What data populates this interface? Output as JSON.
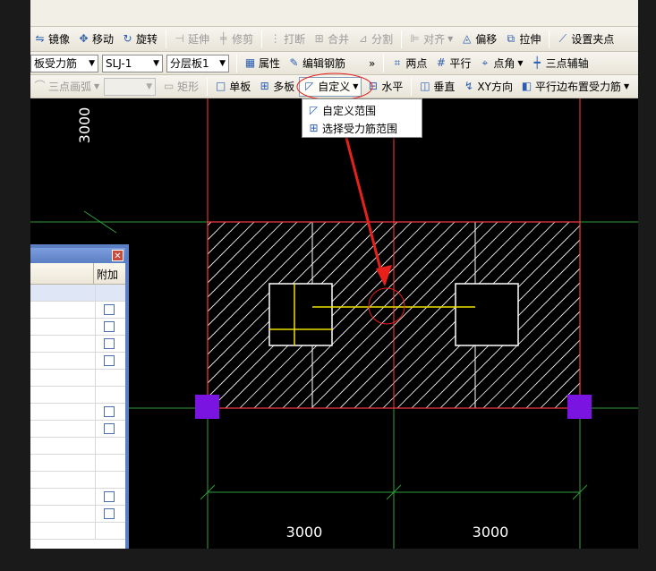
{
  "toolbar_top": {
    "partial_left": "",
    "partial_right": ""
  },
  "toolbar_edit": {
    "mirror": "镜像",
    "move": "移动",
    "rotate": "旋转",
    "extend": "延伸",
    "trim": "修剪",
    "break": "打断",
    "merge": "合并",
    "split": "分割",
    "align": "对齐",
    "offset": "偏移",
    "stretch": "拉伸",
    "set_grip": "设置夹点"
  },
  "toolbar_props": {
    "type_select": "板受力筋",
    "name_select": "SLJ-1",
    "layer_select": "分层板1",
    "properties": "属性",
    "edit_rebar": "编辑钢筋",
    "two_points": "两点",
    "parallel": "平行",
    "point_angle": "点角",
    "three_point_aux": "三点辅轴"
  },
  "toolbar_draw": {
    "three_point_arc": "三点画弧",
    "rectangle": "矩形",
    "single_board": "单板",
    "multi_board": "多板",
    "custom": "自定义",
    "horizontal": "水平",
    "vertical": "垂直",
    "xy_direction": "XY方向",
    "parallel_edge": "平行边布置受力筋"
  },
  "custom_menu": {
    "items": [
      "自定义范围",
      "选择受力筋范围"
    ]
  },
  "panel": {
    "column_header": "附加",
    "rows": [
      {
        "checkbox": false,
        "highlight": true
      },
      {
        "checkbox": true
      },
      {
        "checkbox": true
      },
      {
        "checkbox": true
      },
      {
        "checkbox": true
      },
      {
        "checkbox": false
      },
      {
        "checkbox": false
      },
      {
        "checkbox": true
      },
      {
        "checkbox": true
      },
      {
        "checkbox": false
      },
      {
        "checkbox": false
      },
      {
        "checkbox": false
      },
      {
        "checkbox": true
      },
      {
        "checkbox": true
      },
      {
        "checkbox": false
      }
    ]
  },
  "canvas": {
    "dim_vertical": "3000",
    "dim_left": "3000",
    "dim_right": "3000",
    "colors": {
      "background": "#000000",
      "slab_border": "#ff3b3b",
      "hatch": "#ffffff",
      "axis": "#2f9e3a",
      "column": "#ffffff",
      "rebar": "#f0e000",
      "grip": "#7a14e0",
      "annotation": "#e8201c"
    }
  }
}
